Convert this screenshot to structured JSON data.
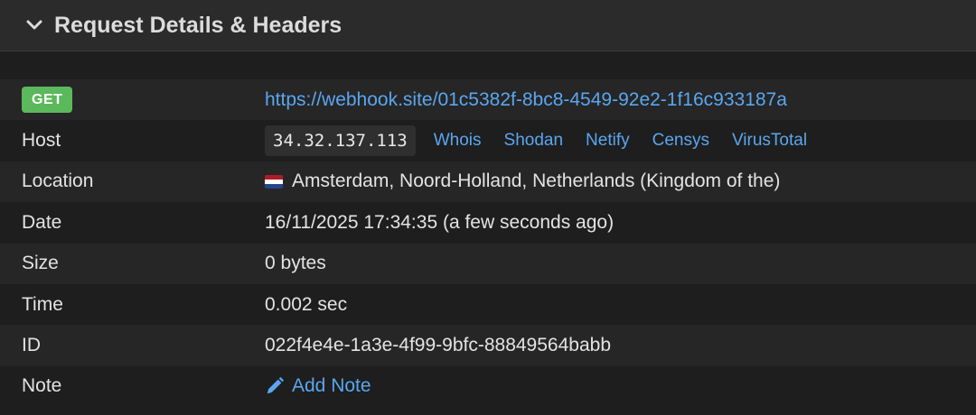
{
  "header": {
    "title": "Request Details & Headers",
    "chevron_icon": "chevron-down-icon"
  },
  "request": {
    "method": "GET",
    "method_color": "#5cb85c",
    "url": "https://webhook.site/01c5382f-8bc8-4549-92e2-1f16c933187a"
  },
  "rows": {
    "host": {
      "label": "Host",
      "ip": "34.32.137.113",
      "links": [
        "Whois",
        "Shodan",
        "Netify",
        "Censys",
        "VirusTotal"
      ]
    },
    "location": {
      "label": "Location",
      "flag_icon": "netherlands-flag-icon",
      "value": "Amsterdam, Noord-Holland, Netherlands (Kingdom of the)"
    },
    "date": {
      "label": "Date",
      "value": "16/11/2025 17:34:35 (a few seconds ago)"
    },
    "size": {
      "label": "Size",
      "value": "0 bytes"
    },
    "time": {
      "label": "Time",
      "value": "0.002 sec"
    },
    "id": {
      "label": "ID",
      "value": "022f4e4e-1a3e-4f99-9bfc-88849564babb"
    },
    "note": {
      "label": "Note",
      "action_icon": "pencil-icon",
      "action_label": "Add Note"
    }
  },
  "colors": {
    "link": "#5aa6f0",
    "background": "#1e1e1e",
    "header_background": "#2b2b2b"
  }
}
